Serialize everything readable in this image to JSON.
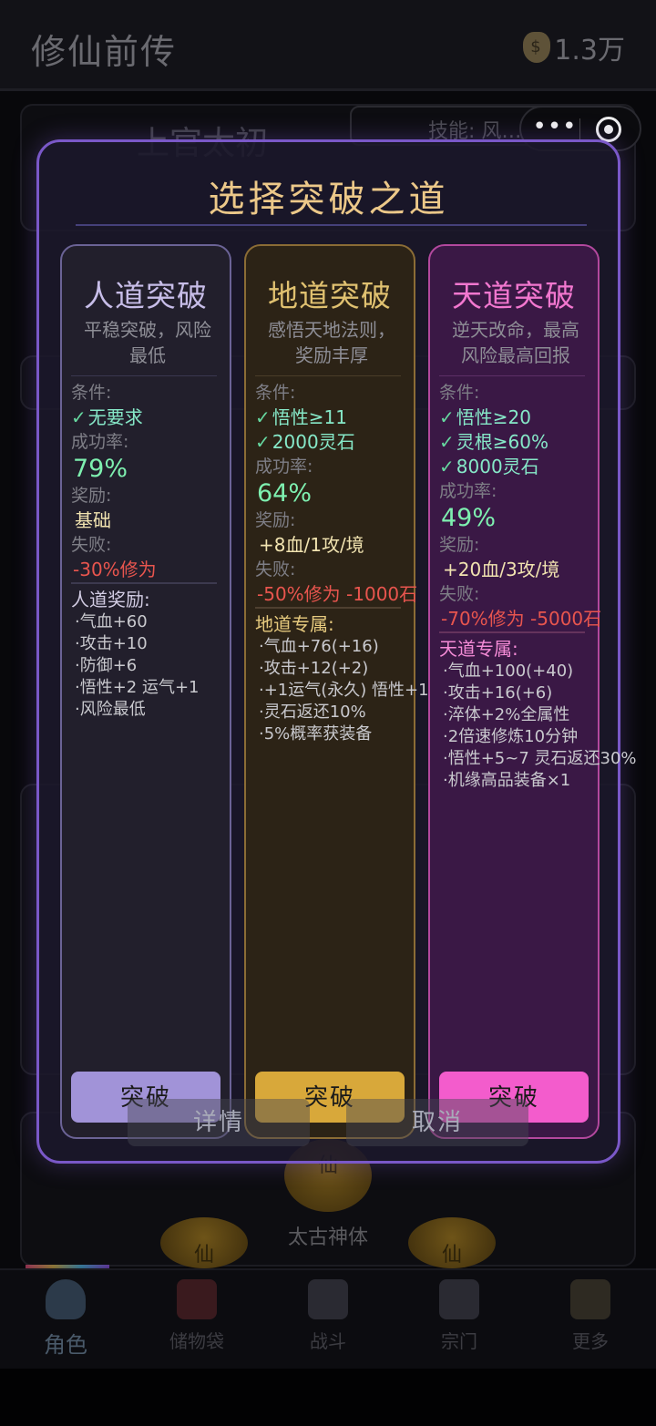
{
  "app": {
    "title": "修仙前传",
    "currency": "1.3万"
  },
  "background": {
    "character_name": "上官太初",
    "skill_badge": "技能: 风…",
    "capsule_menu": "•••",
    "orb_label": "仙",
    "body_label": "太古神体"
  },
  "modal": {
    "title": "选择突破之道",
    "columns": {
      "human": {
        "title": "人道突破",
        "desc_line1": "平稳突破，风险",
        "desc_line2": "最低",
        "cond_label": "条件:",
        "conditions": [
          "无要求"
        ],
        "rate_label": "成功率:",
        "rate": "79%",
        "reward_label": "奖励:",
        "reward": "基础",
        "fail_label": "失败:",
        "fail": "-30%修为",
        "bonus_title": "人道奖励:",
        "bonus": [
          "·气血+60",
          "·攻击+10",
          "·防御+6",
          "·悟性+2 运气+1",
          "·风险最低"
        ],
        "button": "突破"
      },
      "earth": {
        "title": "地道突破",
        "desc_line1": "感悟天地法则，",
        "desc_line2": "奖励丰厚",
        "cond_label": "条件:",
        "conditions": [
          "悟性≥11",
          "2000灵石"
        ],
        "rate_label": "成功率:",
        "rate": "64%",
        "reward_label": "奖励:",
        "reward": "+8血/1攻/境",
        "fail_label": "失败:",
        "fail": "-50%修为 -1000石",
        "bonus_title": "地道专属:",
        "bonus": [
          "·气血+76(+16)",
          "·攻击+12(+2)",
          "·+1运气(永久) 悟性+1",
          "·灵石返还10%",
          "·5%概率获装备"
        ],
        "button": "突破"
      },
      "heaven": {
        "title": "天道突破",
        "desc_line1": "逆天改命，最高",
        "desc_line2": "风险最高回报",
        "cond_label": "条件:",
        "conditions": [
          "悟性≥20",
          "灵根≥60%",
          "8000灵石"
        ],
        "rate_label": "成功率:",
        "rate": "49%",
        "reward_label": "奖励:",
        "reward": "+20血/3攻/境",
        "fail_label": "失败:",
        "fail": "-70%修为 -5000石",
        "bonus_title": "天道专属:",
        "bonus": [
          "·气血+100(+40)",
          "·攻击+16(+6)",
          "·淬体+2%全属性",
          "·2倍速修炼10分钟",
          "·悟性+5~7 灵石返还30%",
          "·机缘高品装备×1"
        ],
        "button": "突破"
      }
    },
    "detail_button": "详情",
    "cancel_button": "取消"
  },
  "tabs": [
    {
      "label": "角色",
      "icon": "character-icon",
      "active": true
    },
    {
      "label": "储物袋",
      "icon": "bag-icon",
      "active": false
    },
    {
      "label": "战斗",
      "icon": "swords-icon",
      "active": false
    },
    {
      "label": "宗门",
      "icon": "temple-icon",
      "active": false
    },
    {
      "label": "更多",
      "icon": "clipboard-icon",
      "active": false
    }
  ],
  "colors": {
    "modal_border": "#7a58c8",
    "title_gold": "#ecc889",
    "success_green": "#7ef0b0",
    "fail_red": "#e8554e",
    "human_button": "#a193d8",
    "earth_button": "#d8a83a",
    "heaven_button": "#f35ccc"
  }
}
